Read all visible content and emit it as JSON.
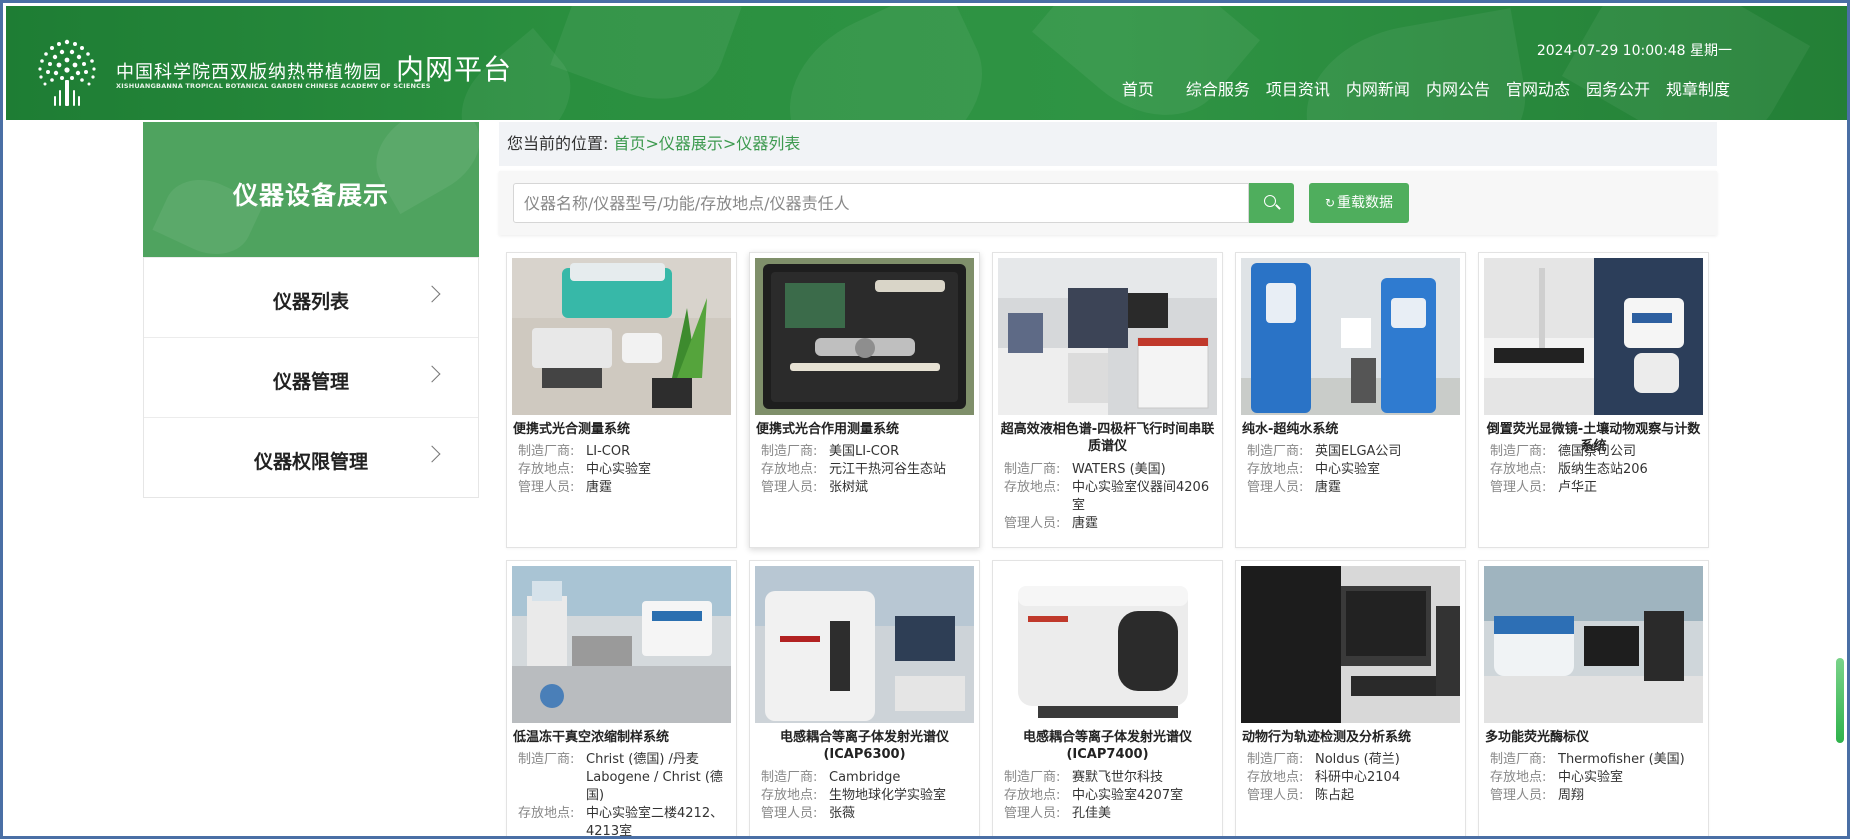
{
  "header": {
    "org_name_cn": "中国科学院西双版纳热带植物园",
    "org_name_en": "XISHUANGBANNA TROPICAL BOTANICAL GARDEN CHINESE ACADEMY OF SCIENCES",
    "platform_title": "内网平台",
    "datetime": "2024-07-29 10:00:48 星期一",
    "nav": [
      "首页",
      "综合服务",
      "项目资讯",
      "内网新闻",
      "内网公告",
      "官网动态",
      "园务公开",
      "规章制度"
    ]
  },
  "sidebar": {
    "title": "仪器设备展示",
    "items": [
      {
        "label": "仪器列表"
      },
      {
        "label": "仪器管理"
      },
      {
        "label": "仪器权限管理"
      }
    ]
  },
  "breadcrumb": {
    "label": "您当前的位置:",
    "path": "首页>仪器展示>仪器列表"
  },
  "search": {
    "placeholder": "仪器名称/仪器型号/功能/存放地点/仪器责任人",
    "reload_icon": "↻",
    "reload_label": "重载数据"
  },
  "field_labels": {
    "manufacturer": "制造厂商:",
    "location": "存放地点:",
    "manager": "管理人员:"
  },
  "instruments": [
    {
      "name": "便携式光合测量系统",
      "manufacturer": "LI-COR",
      "location": "中心实验室",
      "manager": "唐霆"
    },
    {
      "name": "便携式光合作用测量系统",
      "manufacturer": "美国LI-COR",
      "location": "元江干热河谷生态站",
      "manager": "张树斌"
    },
    {
      "name": "超高效液相色谱-四极杆飞行时间串联质谱仪",
      "manufacturer": "WATERS (美国)",
      "location": "中心实验室仪器间4206室",
      "manager": "唐霆"
    },
    {
      "name": "纯水-超纯水系统",
      "manufacturer": "英国ELGA公司",
      "location": "中心实验室",
      "manager": "唐霆"
    },
    {
      "name": "倒置荧光显微镜-土壤动物观察与计数系统",
      "manufacturer": "德国蔡司公司",
      "location": "版纳生态站206",
      "manager": "卢华正"
    },
    {
      "name": "低温冻干真空浓缩制样系统",
      "manufacturer": "Christ (德国) /丹麦Labogene / Christ (德国)",
      "location": "中心实验室二楼4212、4213室",
      "manager": ""
    },
    {
      "name": "电感耦合等离子体发射光谱仪(ICAP6300)",
      "manufacturer": "Cambridge",
      "location": "生物地球化学实验室",
      "manager": "张薇"
    },
    {
      "name": "电感耦合等离子体发射光谱仪(ICAP7400)",
      "manufacturer": "赛默飞世尔科技",
      "location": "中心实验室4207室",
      "manager": "孔佳美"
    },
    {
      "name": "动物行为轨迹检测及分析系统",
      "manufacturer": "Noldus (荷兰)",
      "location": "科研中心2104",
      "manager": "陈占起"
    },
    {
      "name": "多功能荧光酶标仪",
      "manufacturer": "Thermofisher (美国)",
      "location": "中心实验室",
      "manager": "周翔"
    }
  ],
  "colors": {
    "header_green": "#2a8f3f",
    "sidebar_green": "#4fa35f",
    "button_green": "#4fae5d",
    "crumb_green": "#3d9a4f"
  }
}
